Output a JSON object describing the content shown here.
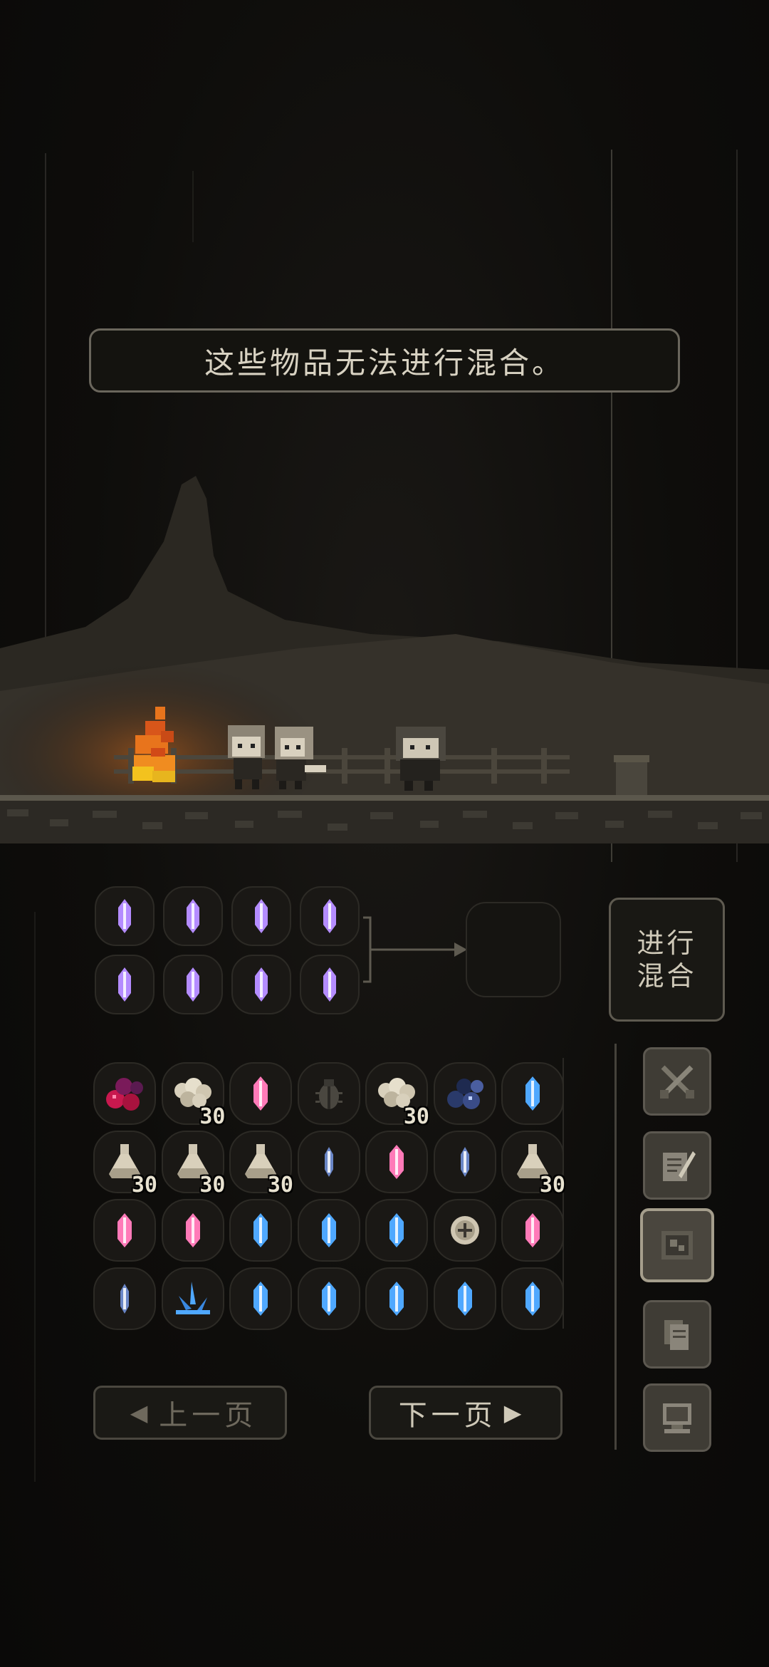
{
  "message": "这些物品无法进行混合。",
  "mix_button_label": "进行\n混合",
  "prev_page_label": "上一页",
  "next_page_label": "下一页",
  "mix_slots": [
    {
      "item": "purple-crystal"
    },
    {
      "item": "purple-crystal"
    },
    {
      "item": "purple-crystal"
    },
    {
      "item": "purple-crystal"
    },
    {
      "item": "purple-crystal"
    },
    {
      "item": "purple-crystal"
    },
    {
      "item": "purple-crystal"
    },
    {
      "item": "purple-crystal"
    }
  ],
  "inventory": [
    {
      "item": "red-berries"
    },
    {
      "item": "cotton-bundle",
      "count": "30"
    },
    {
      "item": "pink-crystal"
    },
    {
      "item": "beetle"
    },
    {
      "item": "cotton-bundle",
      "count": "30"
    },
    {
      "item": "blue-berries"
    },
    {
      "item": "blue-crystal"
    },
    {
      "item": "potion-flask",
      "count": "30"
    },
    {
      "item": "potion-flask",
      "count": "30"
    },
    {
      "item": "potion-flask",
      "count": "30"
    },
    {
      "item": "small-blue-crystal"
    },
    {
      "item": "pink-crystal"
    },
    {
      "item": "small-blue-crystal"
    },
    {
      "item": "potion-flask",
      "count": "30"
    },
    {
      "item": "pink-crystal"
    },
    {
      "item": "pink-crystal"
    },
    {
      "item": "blue-crystal"
    },
    {
      "item": "blue-crystal"
    },
    {
      "item": "blue-crystal"
    },
    {
      "item": "coin-disc"
    },
    {
      "item": "pink-crystal"
    },
    {
      "item": "small-blue-crystal"
    },
    {
      "item": "blue-ice-shard"
    },
    {
      "item": "blue-crystal"
    },
    {
      "item": "blue-crystal"
    },
    {
      "item": "blue-crystal"
    },
    {
      "item": "blue-crystal"
    },
    {
      "item": "blue-crystal"
    }
  ],
  "side_buttons": [
    {
      "icon": "crossed-swords-icon"
    },
    {
      "icon": "scroll-quill-icon"
    },
    {
      "icon": "map-scroll-icon",
      "active": true
    },
    {
      "icon": "documents-icon"
    },
    {
      "icon": "computer-icon"
    }
  ],
  "colors": {
    "accent": "#cfc9b8",
    "fire": "#e8741c",
    "purple_crystal": "#b48cff",
    "pink_crystal": "#ff7ab8",
    "blue_crystal": "#4fa8ff"
  }
}
